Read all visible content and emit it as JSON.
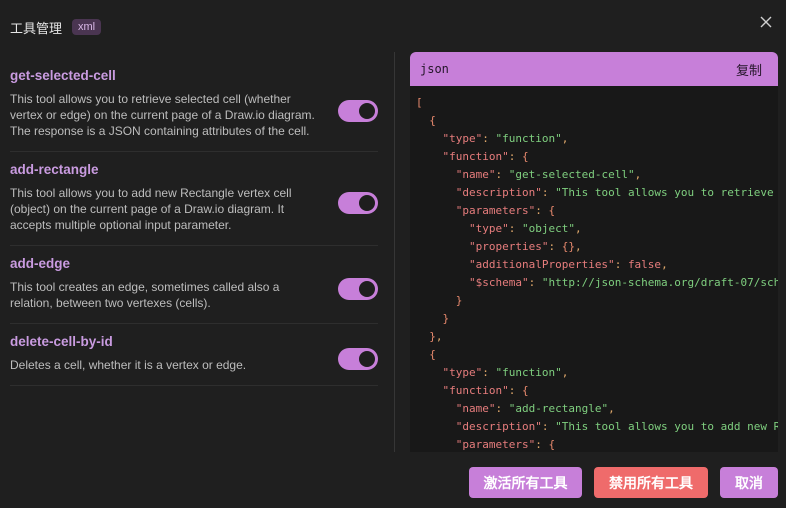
{
  "header": {
    "title": "工具管理",
    "badge": "xml"
  },
  "tools": [
    {
      "name": "get-selected-cell",
      "description": "This tool allows you to retrieve selected cell (whether vertex or edge) on the current page of a Draw.io diagram. The response is a JSON containing attributes of the cell.",
      "enabled": true
    },
    {
      "name": "add-rectangle",
      "description": "This tool allows you to add new Rectangle vertex cell (object) on the current page of a Draw.io diagram. It accepts multiple optional input parameter.",
      "enabled": true
    },
    {
      "name": "add-edge",
      "description": "This tool creates an edge, sometimes called also a relation, between two vertexes (cells).",
      "enabled": true
    },
    {
      "name": "delete-cell-by-id",
      "description": "Deletes a cell, whether it is a vertex or edge.",
      "enabled": true
    }
  ],
  "code": {
    "language": "json",
    "copy_label": "复制",
    "tokens": {
      "type": "\"type\"",
      "function_key": "\"function\"",
      "function_val": "\"function\"",
      "name": "\"name\"",
      "description": "\"description\"",
      "parameters": "\"parameters\"",
      "object": "\"object\"",
      "properties": "\"properties\"",
      "additionalProperties": "\"additionalProperties\"",
      "false": "false",
      "schema": "\"$schema\"",
      "schema_url": "\"http://json-schema.org/draft-07/sch",
      "tool1_name": "\"get-selected-cell\"",
      "tool1_desc": "\"This tool allows you to retrieve",
      "tool2_name": "\"add-rectangle\"",
      "tool2_desc": "\"This tool allows you to add new R"
    }
  },
  "footer": {
    "activate_all": "激活所有工具",
    "disable_all": "禁用所有工具",
    "cancel": "取消"
  }
}
